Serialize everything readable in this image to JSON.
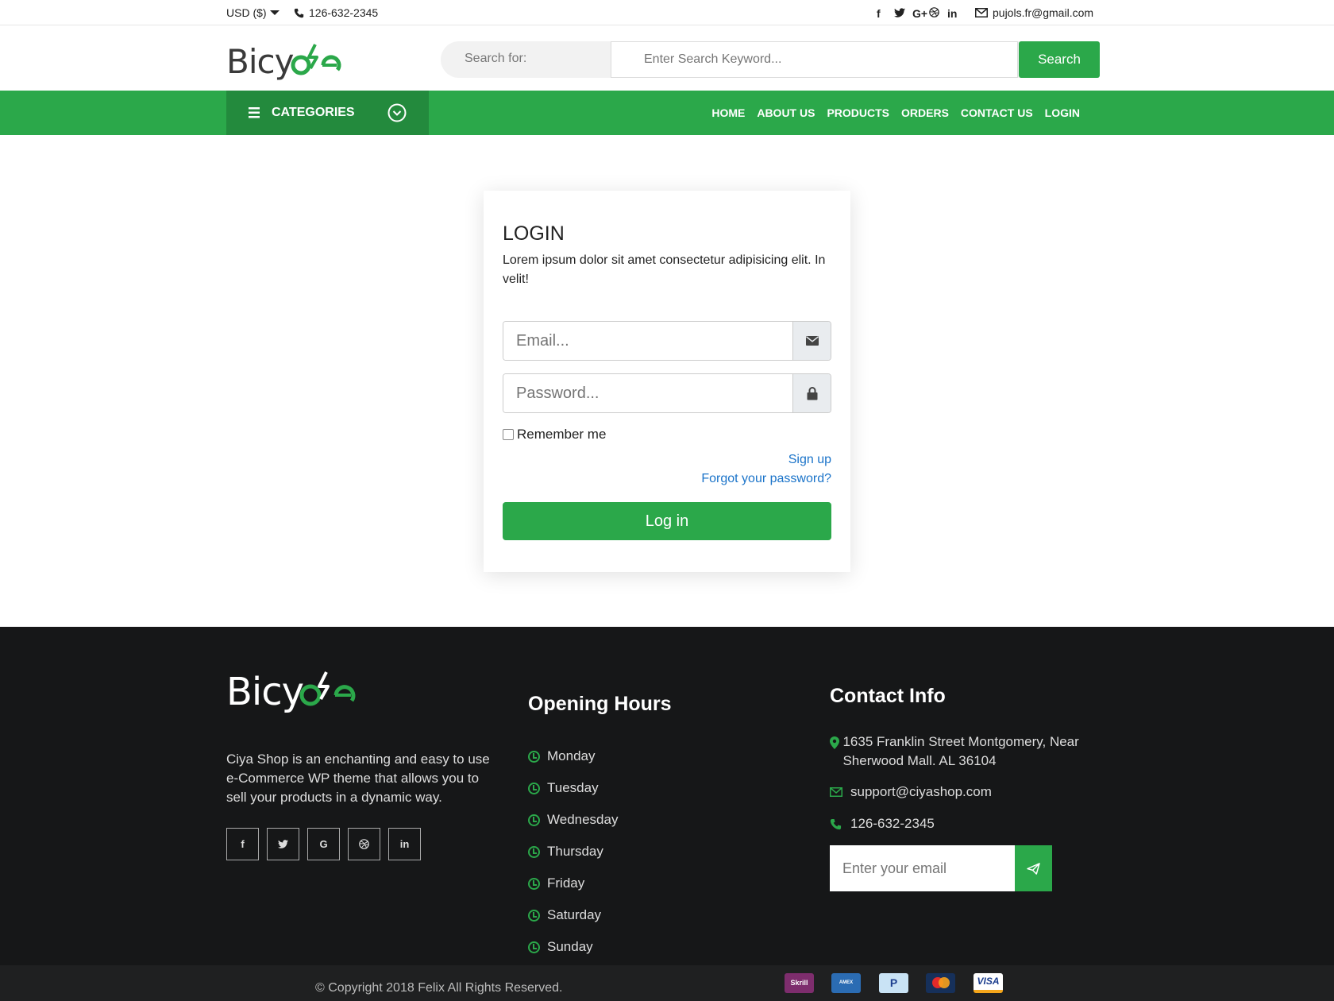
{
  "topbar": {
    "currency": "USD ($)",
    "phone": "126-632-2345",
    "email": "pujols.fr@gmail.com",
    "social_icons": [
      "facebook-icon",
      "twitter-icon",
      "google-plus-icon",
      "dribbble-icon",
      "linkedin-icon"
    ]
  },
  "header": {
    "logo_text": "Bicycle",
    "search_label": "Search for:",
    "search_placeholder": "Enter Search Keyword...",
    "search_button": "Search"
  },
  "nav": {
    "categories_label": "CATEGORIES",
    "links": [
      "HOME",
      "ABOUT US",
      "PRODUCTS",
      "ORDERS",
      "CONTACT US",
      "LOGIN"
    ]
  },
  "login": {
    "title": "LOGIN",
    "description": "Lorem ipsum dolor sit amet consectetur adipisicing elit. In velit!",
    "email_placeholder": "Email...",
    "password_placeholder": "Password...",
    "remember_label": "Remember me",
    "signup_link": "Sign up",
    "forgot_link": "Forgot your password?",
    "submit_label": "Log in"
  },
  "footer": {
    "about_text": "Ciya Shop is an enchanting and easy to use e-Commerce WP theme that allows you to sell your products in a dynamic way.",
    "hours_title": "Opening Hours",
    "days": [
      "Monday",
      "Tuesday",
      "Wednesday",
      "Thursday",
      "Friday",
      "Saturday",
      "Sunday"
    ],
    "contact_title": "Contact Info",
    "address": "1635 Franklin Street Montgomery, Near Sherwood Mall. AL 36104",
    "email": "support@ciyashop.com",
    "phone": "126-632-2345",
    "subscribe_placeholder": "Enter your email",
    "copyright": "© Copyright 2018 Felix All Rights Reserved.",
    "payment_methods": [
      "Skrill",
      "American Express",
      "PayPal",
      "MasterCard",
      "VISA"
    ]
  },
  "colors": {
    "brand_green": "#2ba84a",
    "dark_green": "#238a3d",
    "footer_bg": "#161718",
    "link_blue": "#1a73c9"
  }
}
